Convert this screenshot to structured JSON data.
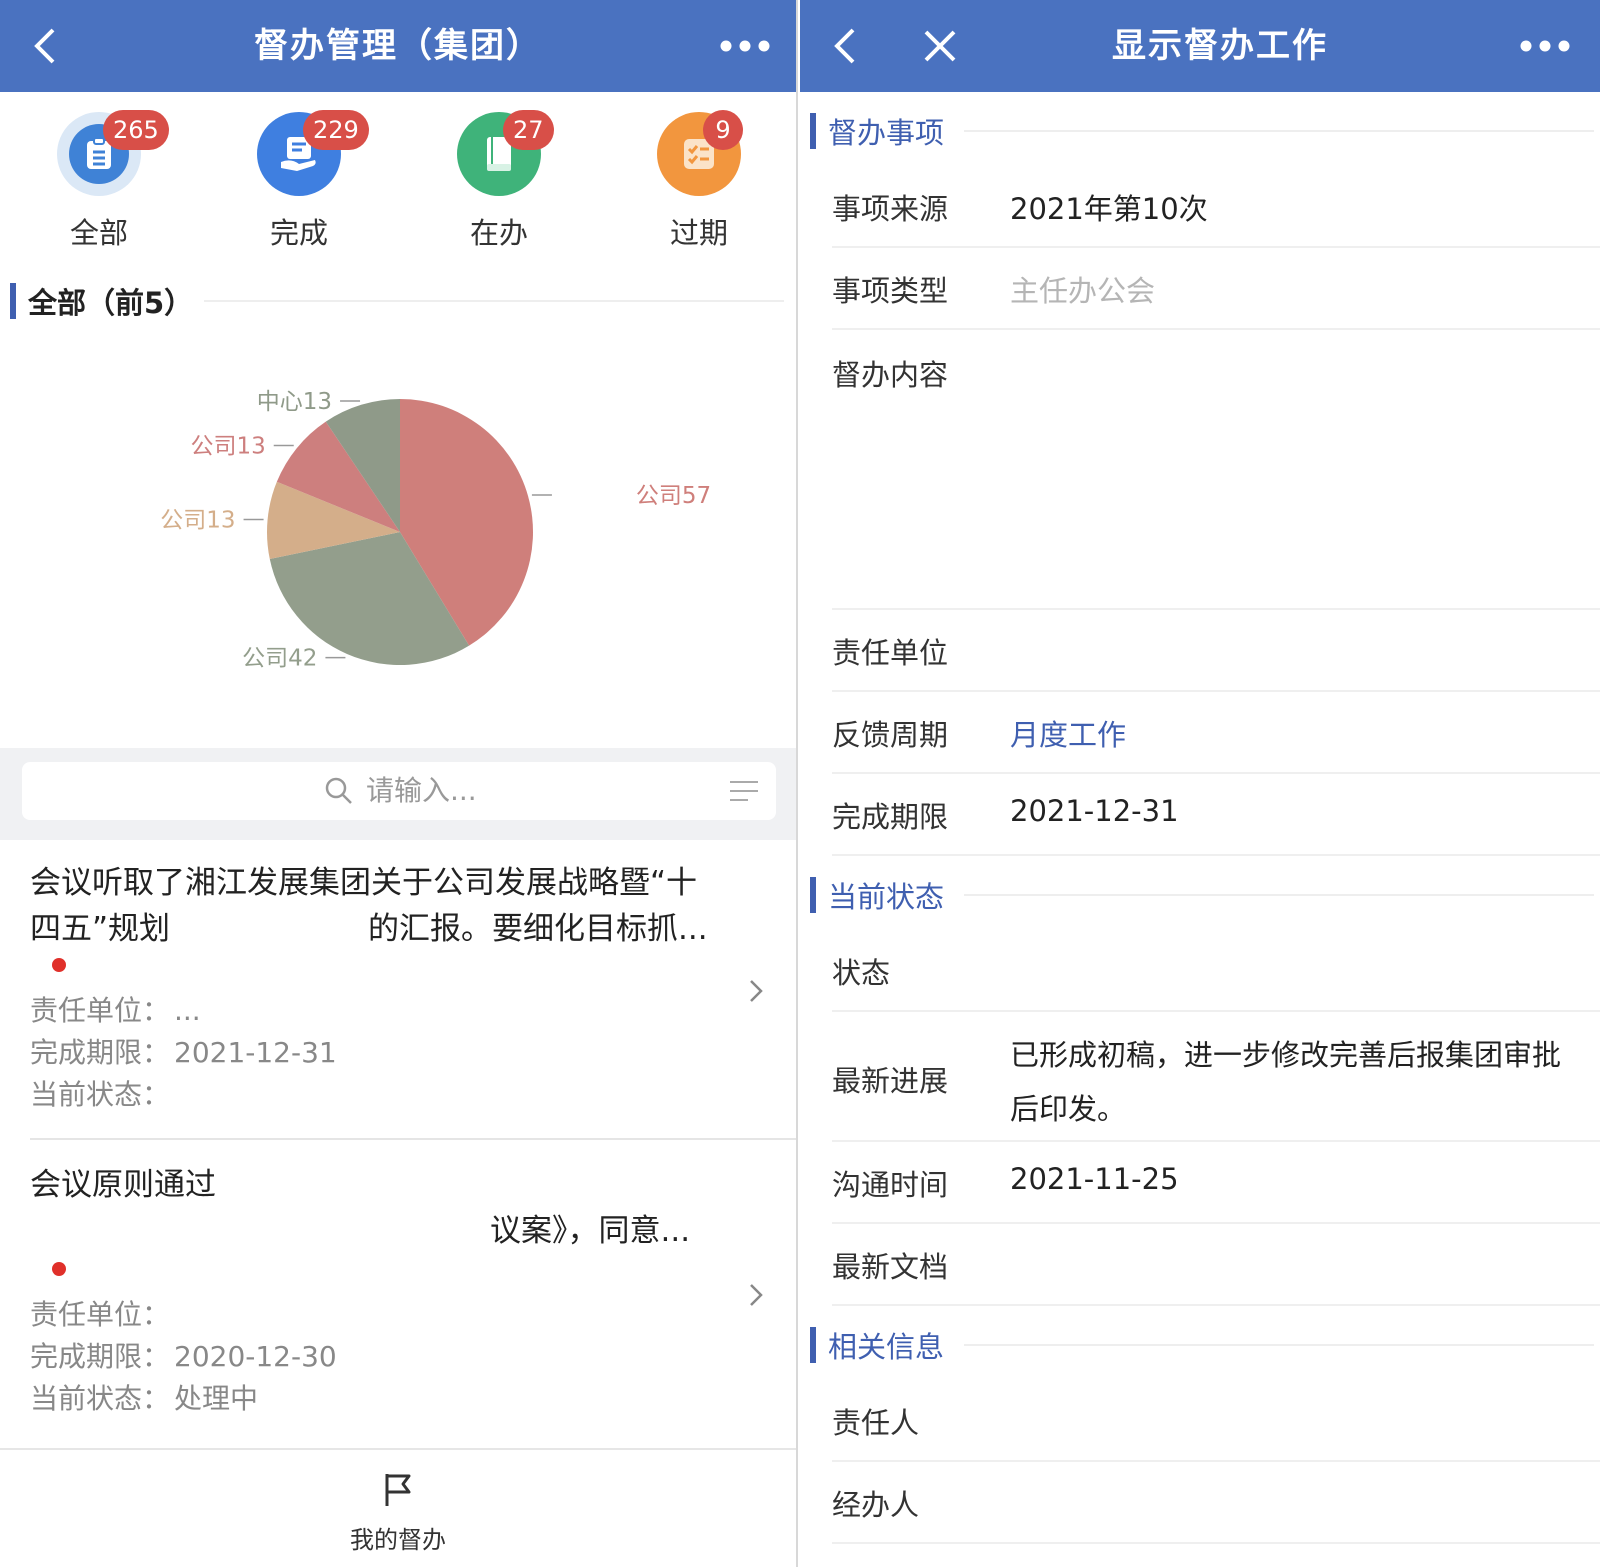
{
  "left": {
    "title": "督办管理（集团）",
    "stats": [
      {
        "label": "全部",
        "count": "265",
        "color": "#3f82d6",
        "icon": "clipboard-icon"
      },
      {
        "label": "完成",
        "count": "229",
        "color": "#3f7fe0",
        "icon": "hand-document-icon"
      },
      {
        "label": "在办",
        "count": "27",
        "color": "#3fb37a",
        "icon": "book-icon"
      },
      {
        "label": "过期",
        "count": "9",
        "color": "#f2963e",
        "icon": "checklist-icon"
      }
    ],
    "chart_section_title": "全部（前5）",
    "chart_data": {
      "type": "pie",
      "slices": [
        {
          "label": "公司57",
          "value": 57,
          "color": "#cf7f7b"
        },
        {
          "label": "公司42",
          "value": 42,
          "color": "#939e8c"
        },
        {
          "label": "公司13",
          "value": 13,
          "color": "#d4ae8a"
        },
        {
          "label": "公司13",
          "value": 13,
          "color": "#cd7f7e"
        },
        {
          "label": "中心13",
          "value": 13,
          "color": "#8f9a89"
        }
      ]
    },
    "search": {
      "placeholder": "请输入..."
    },
    "items": [
      {
        "line1": "会议听取了湘江发展集团关于公司发展战略暨“十",
        "line2a": "四五”规划",
        "line2b": "的汇报。要细化目标抓...",
        "unit_label": "责任单位：",
        "unit_value": "...",
        "deadline_label": "完成期限：",
        "deadline_value": "2021-12-31",
        "status_label": "当前状态：",
        "status_value": ""
      },
      {
        "line1": "会议原则通过",
        "line2b": "议案》，同意...",
        "unit_label": "责任单位：",
        "unit_value": "",
        "deadline_label": "完成期限：",
        "deadline_value": "2020-12-30",
        "status_label": "当前状态：",
        "status_value": "处理中"
      }
    ],
    "tab_label": "我的督办"
  },
  "right": {
    "title": "显示督办工作",
    "section1": "督办事项",
    "source_label": "事项来源",
    "source_value": "2021年第10次",
    "type_label": "事项类型",
    "type_value": "主任办公会",
    "content_label": "督办内容",
    "unit_label": "责任单位",
    "cycle_label": "反馈周期",
    "cycle_value": "月度工作",
    "deadline_label": "完成期限",
    "deadline_value": "2021-12-31",
    "section2": "当前状态",
    "state_label": "状态",
    "progress_label": "最新进展",
    "progress_line1": "已形成初稿，进一步修改完善后报集团审批",
    "progress_line2": "后印发。",
    "comm_label": "沟通时间",
    "comm_value": "2021-11-25",
    "doc_label": "最新文档",
    "section3": "相关信息",
    "owner_label": "责任人",
    "handler_label": "经办人"
  }
}
